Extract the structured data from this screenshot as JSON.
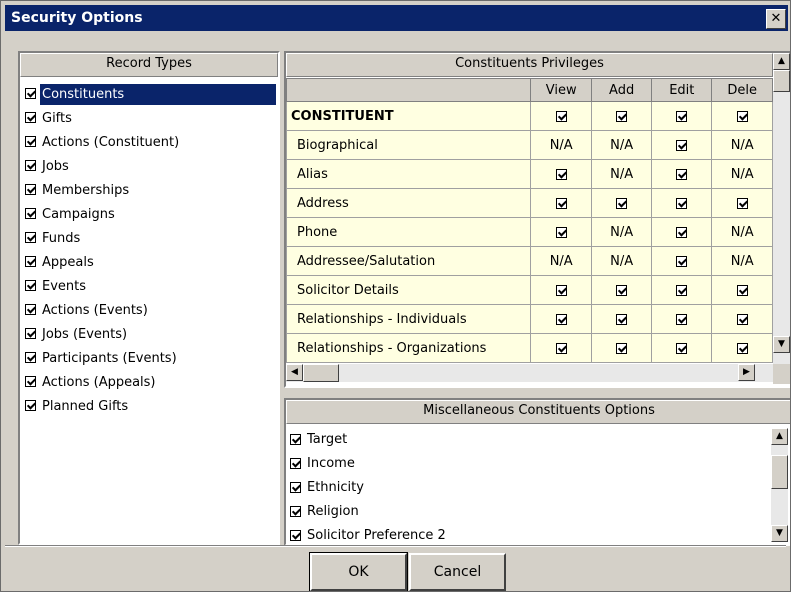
{
  "window": {
    "title": "Security Options",
    "close_glyph": "✕"
  },
  "record_types": {
    "header": "Record Types",
    "items": [
      {
        "label": "Constituents",
        "checked": true,
        "selected": true
      },
      {
        "label": "Gifts",
        "checked": true
      },
      {
        "label": "Actions (Constituent)",
        "checked": true
      },
      {
        "label": "Jobs",
        "checked": true
      },
      {
        "label": "Memberships",
        "checked": true
      },
      {
        "label": "Campaigns",
        "checked": true
      },
      {
        "label": "Funds",
        "checked": true
      },
      {
        "label": "Appeals",
        "checked": true
      },
      {
        "label": "Events",
        "checked": true
      },
      {
        "label": "Actions (Events)",
        "checked": true
      },
      {
        "label": "Jobs (Events)",
        "checked": true
      },
      {
        "label": "Participants (Events)",
        "checked": true
      },
      {
        "label": "Actions (Appeals)",
        "checked": true
      },
      {
        "label": "Planned Gifts",
        "checked": true
      }
    ]
  },
  "privileges": {
    "header": "Constituents Privileges",
    "columns": [
      "",
      "View",
      "Add",
      "Edit",
      "Dele"
    ],
    "rows": [
      {
        "name": "CONSTITUENT",
        "bold": true,
        "cells": [
          "check",
          "check",
          "check",
          "check"
        ]
      },
      {
        "name": "Biographical",
        "cells": [
          "N/A",
          "N/A",
          "check",
          "N/A"
        ]
      },
      {
        "name": "Alias",
        "cells": [
          "check",
          "N/A",
          "check",
          "N/A"
        ]
      },
      {
        "name": "Address",
        "cells": [
          "check",
          "check",
          "check",
          "check"
        ]
      },
      {
        "name": "Phone",
        "cells": [
          "check",
          "N/A",
          "check",
          "N/A"
        ]
      },
      {
        "name": "Addressee/Salutation",
        "cells": [
          "N/A",
          "N/A",
          "check",
          "N/A"
        ]
      },
      {
        "name": "Solicitor Details",
        "cells": [
          "check",
          "check",
          "check",
          "check"
        ]
      },
      {
        "name": "Relationships - Individuals",
        "cells": [
          "check",
          "check",
          "check",
          "check"
        ]
      },
      {
        "name": "Relationships - Organizations",
        "cells": [
          "check",
          "check",
          "check",
          "check"
        ]
      }
    ],
    "scroll_up_glyph": "▲",
    "scroll_down_glyph": "▼",
    "scroll_left_glyph": "◀",
    "scroll_right_glyph": "▶"
  },
  "misc": {
    "header": "Miscellaneous Constituents Options",
    "items": [
      {
        "label": "Target",
        "checked": true
      },
      {
        "label": "Income",
        "checked": true
      },
      {
        "label": "Ethnicity",
        "checked": true
      },
      {
        "label": "Religion",
        "checked": true
      },
      {
        "label": "Solicitor Preference 2",
        "checked": true
      }
    ]
  },
  "buttons": {
    "ok": "OK",
    "cancel": "Cancel"
  }
}
